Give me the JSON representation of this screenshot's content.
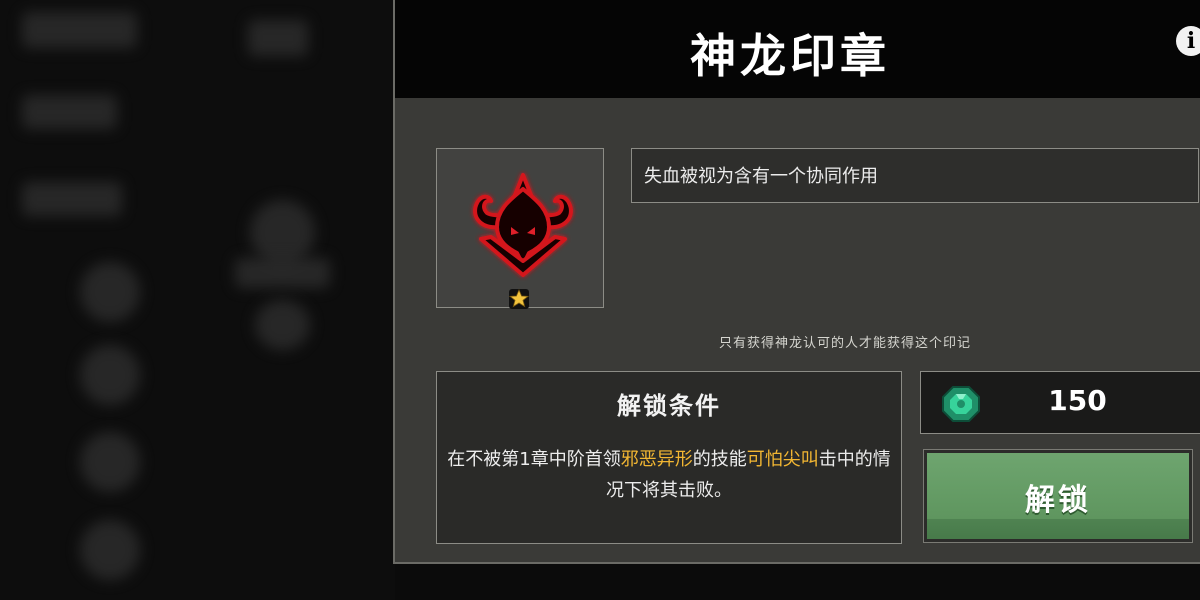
{
  "modal": {
    "title": "神龙印章",
    "info_icon": "info-icon",
    "info_glyph": "i"
  },
  "seal": {
    "icon": "demon-sigil-icon",
    "badge_icon": "star-badge-icon",
    "description": "失血被视为含有一个协同作用",
    "flavor_text": "只有获得神龙认可的人才能获得这个印记"
  },
  "unlock_condition": {
    "title": "解锁条件",
    "text_before": "在不被第1章中阶首领",
    "boss_name": "邪恶异形",
    "text_middle": "的技能",
    "skill_name": "可怕尖叫",
    "text_after": "击中的情况下将其击败。"
  },
  "cost": {
    "currency_icon": "emerald-gem-icon",
    "value": "150"
  },
  "unlock_button": {
    "label": "解锁"
  },
  "colors": {
    "highlight": "#f2b632",
    "button_green": "#6ea56f",
    "sigil_red": "#c0141c",
    "gem_green": "#2fbf8a"
  }
}
